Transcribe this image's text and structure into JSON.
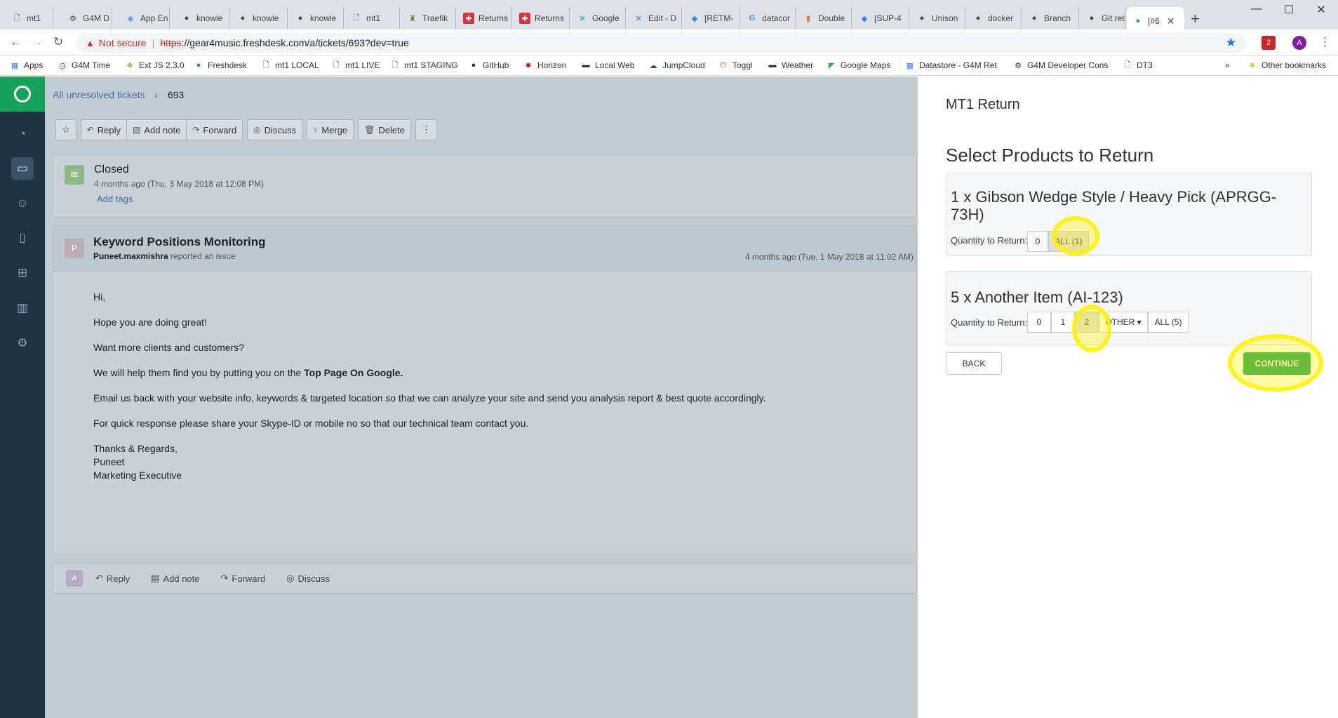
{
  "browser": {
    "tabs": [
      {
        "label": "mt1",
        "icon": "page-icon"
      },
      {
        "label": "G4M D",
        "icon": "gear-icon"
      },
      {
        "label": "App En",
        "icon": "app-engine-icon"
      },
      {
        "label": "knowle",
        "icon": "github-icon"
      },
      {
        "label": "knowle",
        "icon": "github-icon"
      },
      {
        "label": "knowle",
        "icon": "github-icon"
      },
      {
        "label": "mt1",
        "icon": "page-icon"
      },
      {
        "label": "Traefik",
        "icon": "traefik-icon"
      },
      {
        "label": "Returns",
        "icon": "returns-icon"
      },
      {
        "label": "Returns",
        "icon": "returns-icon"
      },
      {
        "label": "Google",
        "icon": "confluence-icon"
      },
      {
        "label": "Edit - D",
        "icon": "confluence-icon"
      },
      {
        "label": "[RETM-",
        "icon": "jira-icon"
      },
      {
        "label": "datacor",
        "icon": "google-icon"
      },
      {
        "label": "Double",
        "icon": "stackoverflow-icon"
      },
      {
        "label": "[SUP-4",
        "icon": "jira-icon"
      },
      {
        "label": "Unison",
        "icon": "github-icon"
      },
      {
        "label": "docker",
        "icon": "github-icon"
      },
      {
        "label": "Branch",
        "icon": "github-icon"
      },
      {
        "label": "Git reb",
        "icon": "github-icon"
      },
      {
        "label": "[#6",
        "icon": "freshdesk-icon"
      }
    ],
    "not_secure": "Not secure",
    "url_scheme": "https",
    "url_rest": "://gear4music.freshdesk.com/a/tickets/693?dev=true",
    "profile_initial": "A",
    "ext_badge": "2",
    "bookmarks": [
      {
        "label": "Apps"
      },
      {
        "label": "G4M Time"
      },
      {
        "label": "Ext JS 2.3.0"
      },
      {
        "label": "Freshdesk"
      },
      {
        "label": "mt1 LOCAL"
      },
      {
        "label": "mt1 LIVE"
      },
      {
        "label": "mt1 STAGING"
      },
      {
        "label": "GitHub"
      },
      {
        "label": "Horizon"
      },
      {
        "label": "Local Web"
      },
      {
        "label": "JumpCloud"
      },
      {
        "label": "Toggl"
      },
      {
        "label": "Weather"
      },
      {
        "label": "Google Maps"
      },
      {
        "label": "Datastore - G4M Ret"
      },
      {
        "label": "G4M Developer Cons"
      },
      {
        "label": "DT3"
      }
    ],
    "overflow": "»",
    "other_bookmarks": "Other bookmarks"
  },
  "breadcrumb": {
    "parent": "All unresolved tickets",
    "current": "693"
  },
  "toolbar": {
    "reply": "Reply",
    "add_note": "Add note",
    "forward": "Forward",
    "discuss": "Discuss",
    "merge": "Merge",
    "delete": "Delete"
  },
  "status": {
    "title": "Closed",
    "time": "4 months ago (Thu, 3 May 2018 at 12:08 PM)",
    "add_tags": "Add tags"
  },
  "ticket": {
    "avatar": "P",
    "subject": "Keyword Positions Monitoring",
    "reporter": "Puneet.maxmishra",
    "reported_text": " reported an issue",
    "date": "4 months ago (Tue, 1 May 2018 at 11:02 AM)",
    "body": {
      "greeting": "Hi,",
      "line1": "Hope you are doing great!",
      "line2": "Want more clients and customers?",
      "line3_pre": "We will help them find you by putting you on the ",
      "line3_bold": "Top Page On Google.",
      "line4": "Email us back with your website info, keywords & targeted location so that we can analyze your site and send you analysis report & best quote accordingly.",
      "line5": "For quick response please share your Skype-ID or mobile no so that our technical team contact you.",
      "sign1": "Thanks & Regards,",
      "sign2": "Puneet",
      "sign3": "Marketing Executive"
    }
  },
  "reply_bar": {
    "avatar": "A",
    "reply": "Reply",
    "add_note": "Add note",
    "forward": "Forward",
    "discuss": "Discuss"
  },
  "panel": {
    "title": "MT1 Return",
    "heading": "Select Products to Return",
    "products": [
      {
        "name_line1": "1 x Gibson Wedge Style / Heavy Pick (APRGG-",
        "name_line2": "73H)",
        "qty_label": "Quantity to Return:",
        "options": [
          "0",
          "ALL (1)"
        ],
        "selected": "ALL (1)"
      },
      {
        "name": "5 x Another Item (AI-123)",
        "qty_label": "Quantity to Return:",
        "options": [
          "0",
          "1",
          "2",
          "OTHER ▾",
          "ALL (5)"
        ],
        "selected": "2"
      }
    ],
    "back": "BACK",
    "continue": "CONTINUE"
  }
}
